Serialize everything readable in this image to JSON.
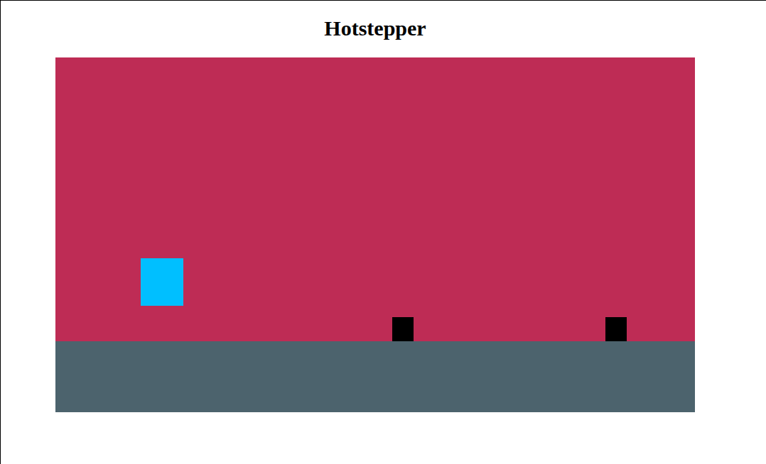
{
  "title": "Hotstepper",
  "game": {
    "player": {
      "kind": "player"
    },
    "obstacles": [
      {
        "kind": "block"
      },
      {
        "kind": "block"
      }
    ]
  }
}
